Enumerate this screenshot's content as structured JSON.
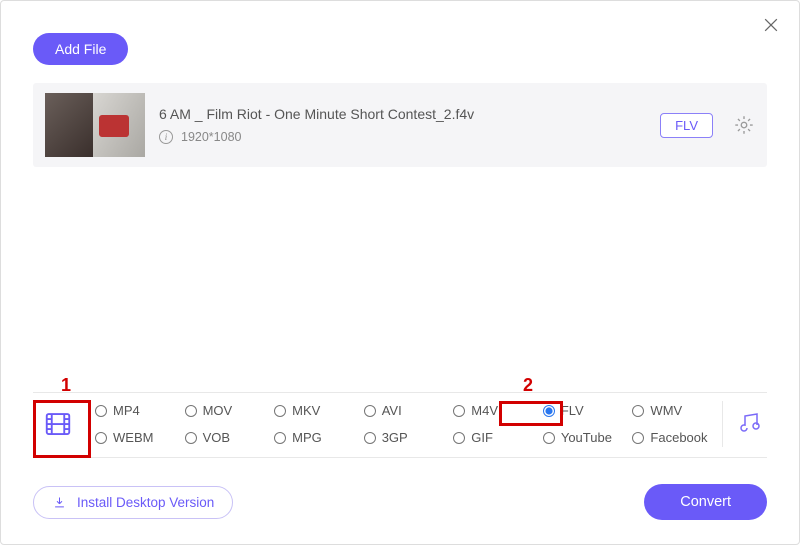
{
  "header": {
    "add_file_label": "Add File"
  },
  "file": {
    "name": "6 AM _ Film Riot - One Minute Short Contest_2.f4v",
    "resolution": "1920*1080",
    "format_pill": "FLV"
  },
  "annotations": {
    "one": "1",
    "two": "2"
  },
  "formats": {
    "row1": [
      "MP4",
      "MOV",
      "MKV",
      "AVI",
      "M4V",
      "FLV",
      "WMV"
    ],
    "row2": [
      "WEBM",
      "VOB",
      "MPG",
      "3GP",
      "GIF",
      "YouTube",
      "Facebook"
    ],
    "selected": "FLV"
  },
  "footer": {
    "install_label": "Install Desktop Version",
    "convert_label": "Convert"
  }
}
